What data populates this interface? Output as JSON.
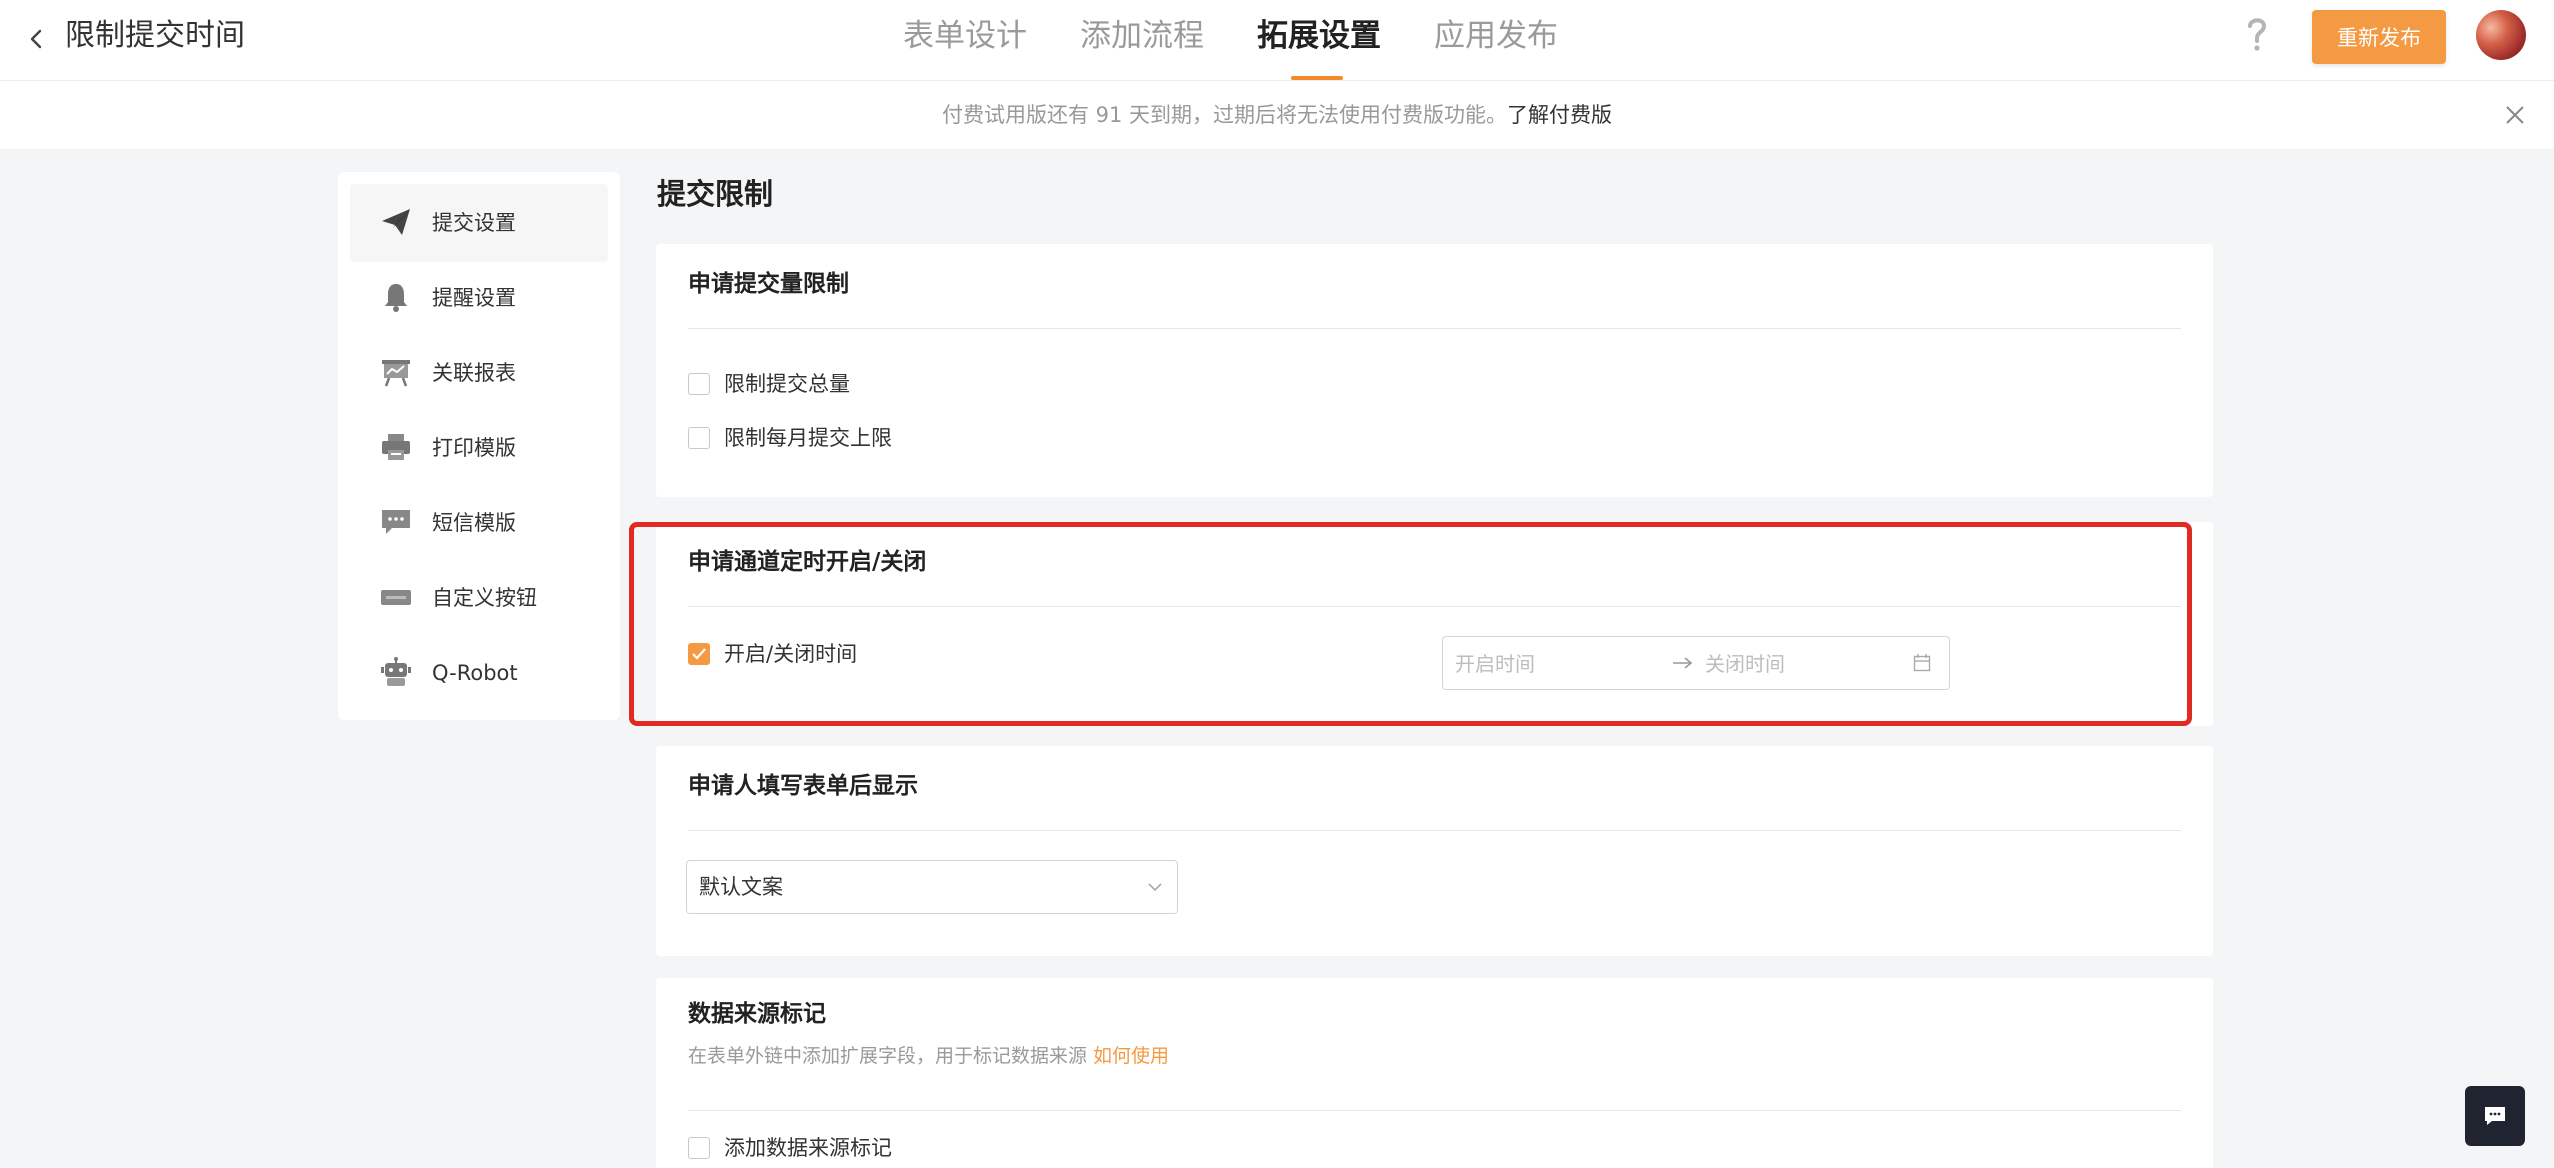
{
  "header": {
    "title": "限制提交时间",
    "tabs": [
      {
        "label": "表单设计",
        "active": false
      },
      {
        "label": "添加流程",
        "active": false
      },
      {
        "label": "拓展设置",
        "active": true
      },
      {
        "label": "应用发布",
        "active": false
      }
    ],
    "republish_label": "重新发布",
    "accent_color": "#f49a42"
  },
  "notice": {
    "text": "付费试用版还有 91 天到期，过期后将无法使用付费版功能。",
    "link_label": "了解付费版"
  },
  "sidebar": {
    "items": [
      {
        "label": "提交设置",
        "icon": "paper-plane-icon",
        "active": true
      },
      {
        "label": "提醒设置",
        "icon": "bell-icon",
        "active": false
      },
      {
        "label": "关联报表",
        "icon": "report-board-icon",
        "active": false
      },
      {
        "label": "打印模版",
        "icon": "printer-icon",
        "active": false
      },
      {
        "label": "短信模版",
        "icon": "sms-bubble-icon",
        "active": false
      },
      {
        "label": "自定义按钮",
        "icon": "custom-button-icon",
        "active": false
      },
      {
        "label": "Q-Robot",
        "icon": "robot-icon",
        "active": false
      }
    ]
  },
  "main": {
    "title": "提交限制",
    "submission_limit": {
      "title": "申请提交量限制",
      "options": [
        {
          "label": "限制提交总量",
          "checked": false
        },
        {
          "label": "限制每月提交上限",
          "checked": false
        }
      ]
    },
    "schedule": {
      "title": "申请通道定时开启/关闭",
      "option": {
        "label": "开启/关闭时间",
        "checked": true
      },
      "start_placeholder": "开启时间",
      "end_placeholder": "关闭时间"
    },
    "after_submit": {
      "title": "申请人填写表单后显示",
      "select_value": "默认文案"
    },
    "data_source": {
      "title": "数据来源标记",
      "description": "在表单外链中添加扩展字段，用于标记数据来源 ",
      "link_label": "如何使用",
      "option": {
        "label": "添加数据来源标记",
        "checked": false
      }
    }
  }
}
